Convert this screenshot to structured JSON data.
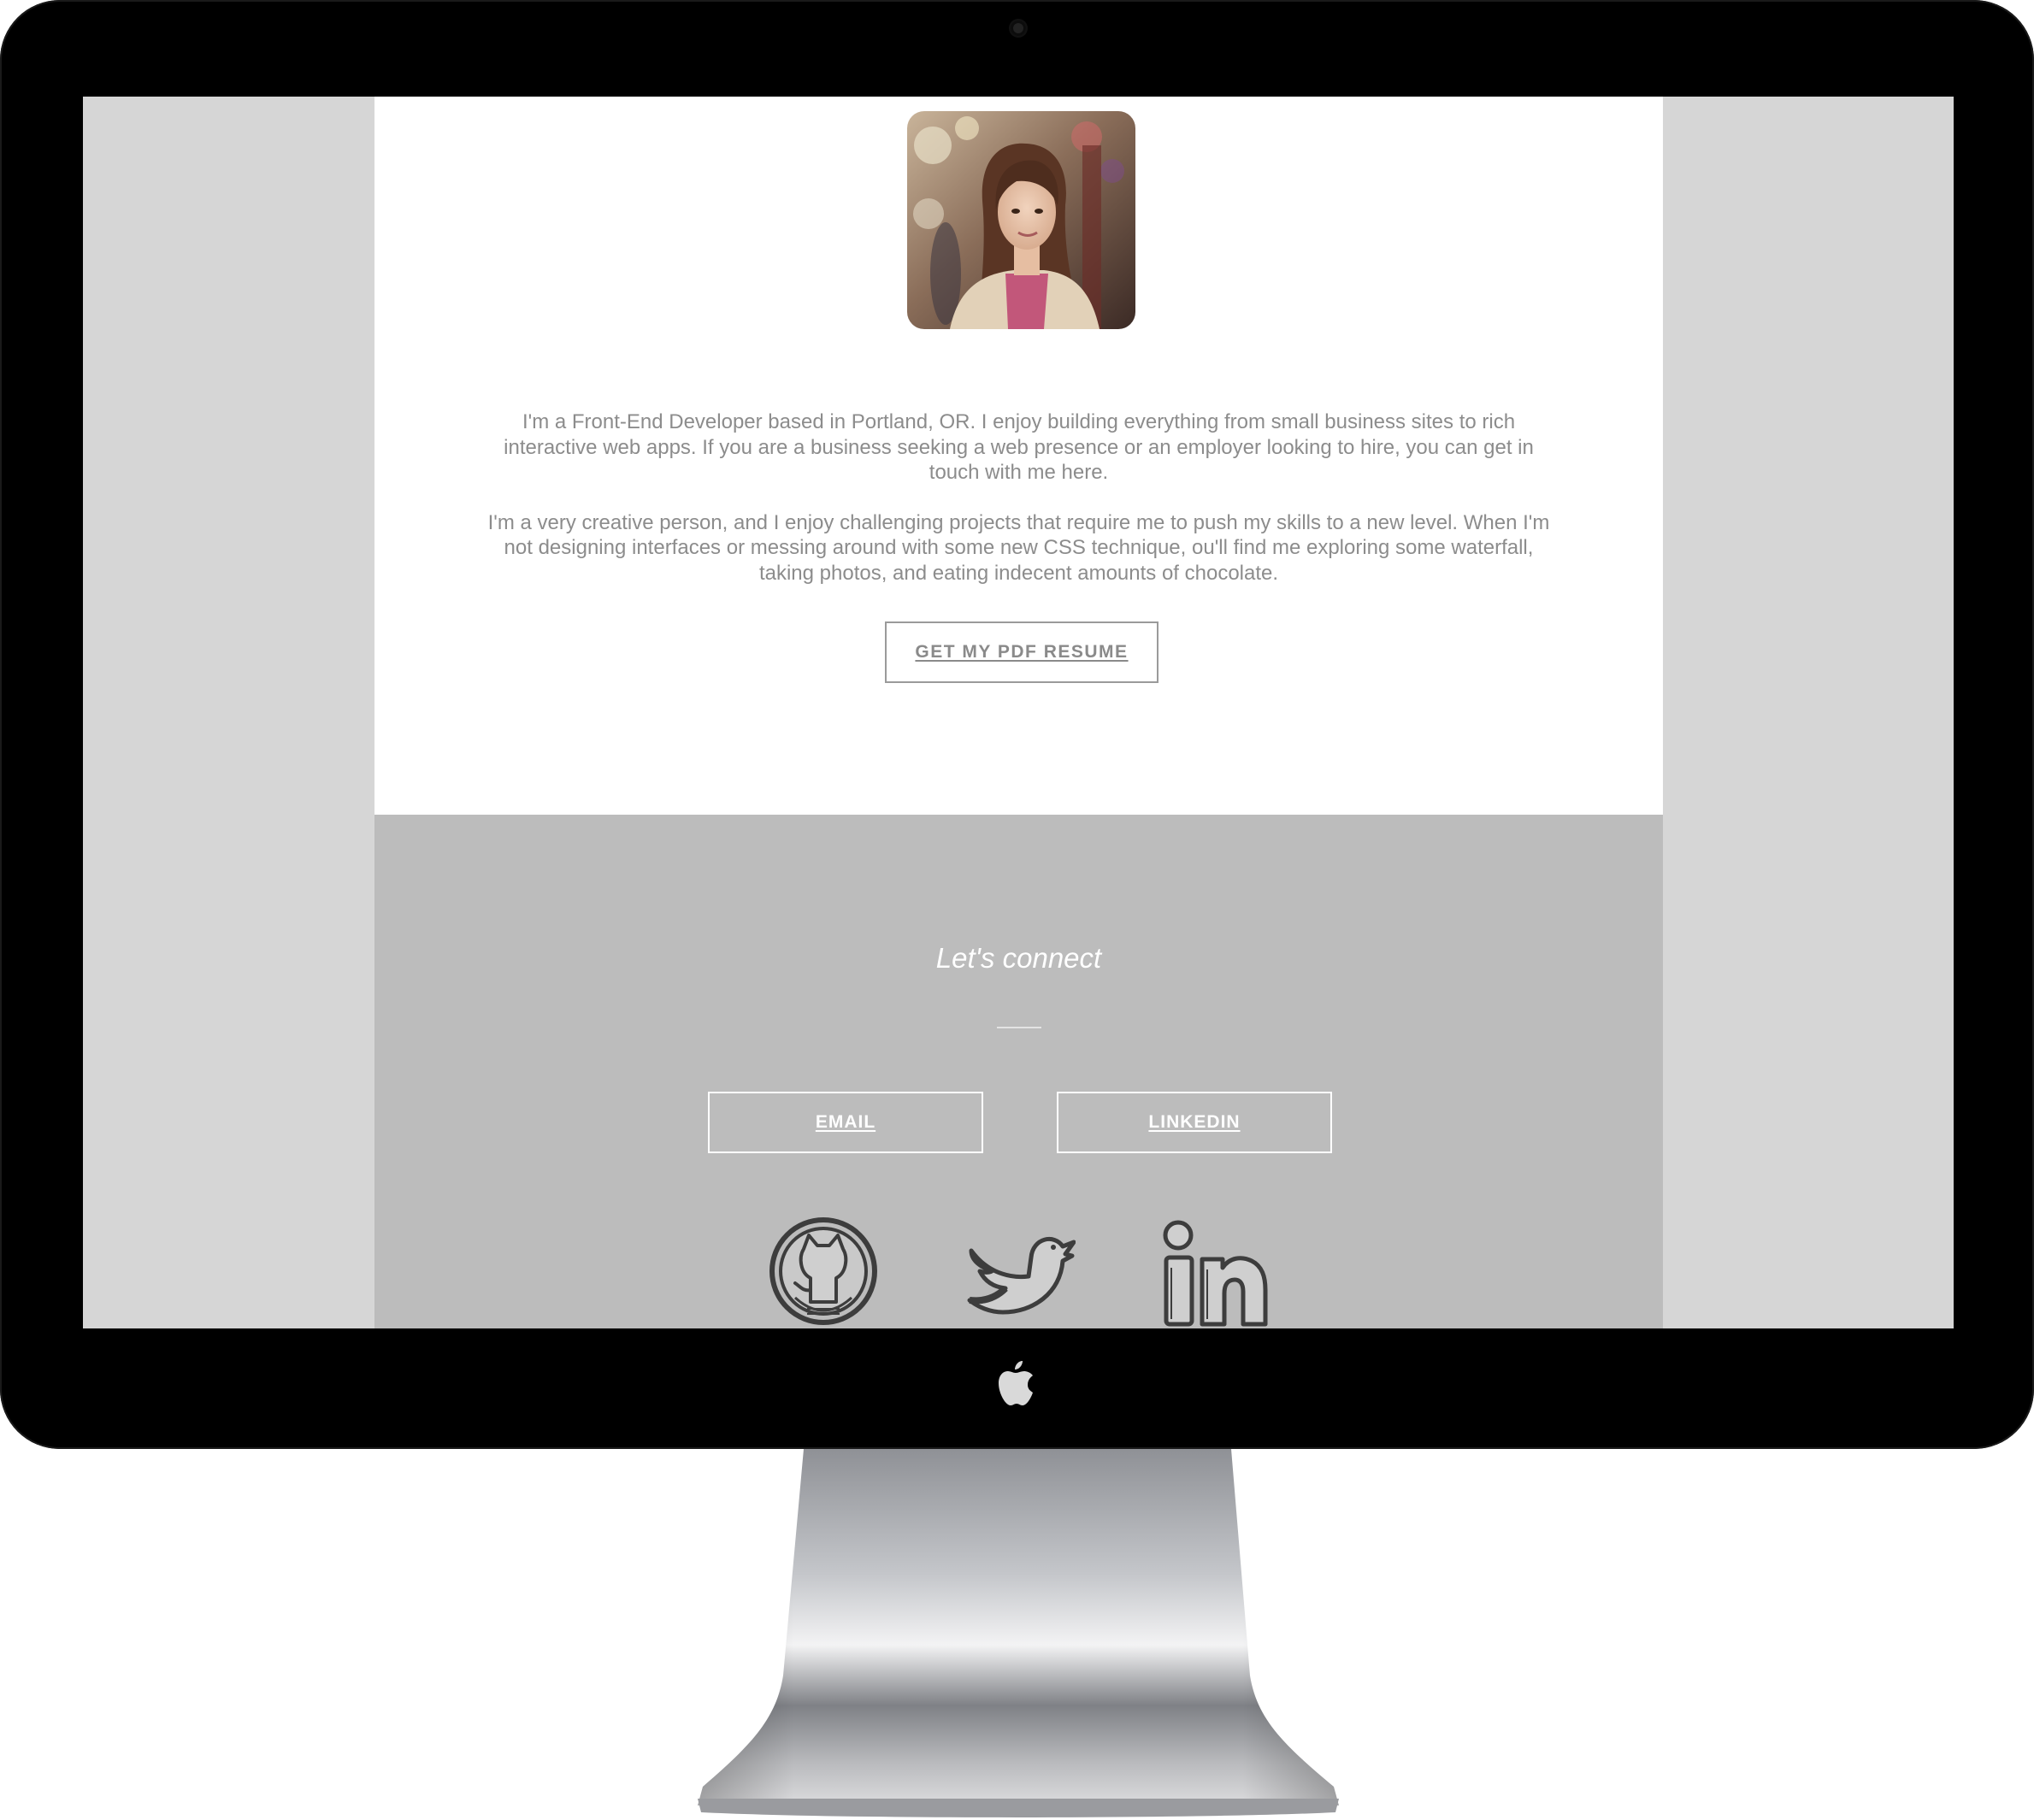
{
  "about": {
    "paragraphs": [
      "I'm a Front-End Developer based in Portland, OR. I enjoy building everything from small business sites to rich interactive web apps. If you are a business seeking a web presence or an employer looking to hire, you can get in touch with me here.",
      "I'm a very creative person, and I enjoy challenging projects that require me to push my skills to a new level. When I'm not designing interfaces or messing around with some new CSS technique, ou'll find me exploring some waterfall, taking photos, and eating indecent amounts of chocolate."
    ],
    "resume_button": "GET MY PDF RESUME"
  },
  "connect": {
    "title": "Let's connect",
    "buttons": {
      "email": "EMAIL",
      "linkedin": "LINKEDIN"
    },
    "social_icons": [
      "github-icon",
      "twitter-icon",
      "linkedin-icon"
    ]
  },
  "colors": {
    "screen_side_bg": "#d6d6d6",
    "content_bg": "#ffffff",
    "connect_bg": "#bcbcbc",
    "body_text": "#8c8c8c",
    "bezel": "#000000"
  }
}
